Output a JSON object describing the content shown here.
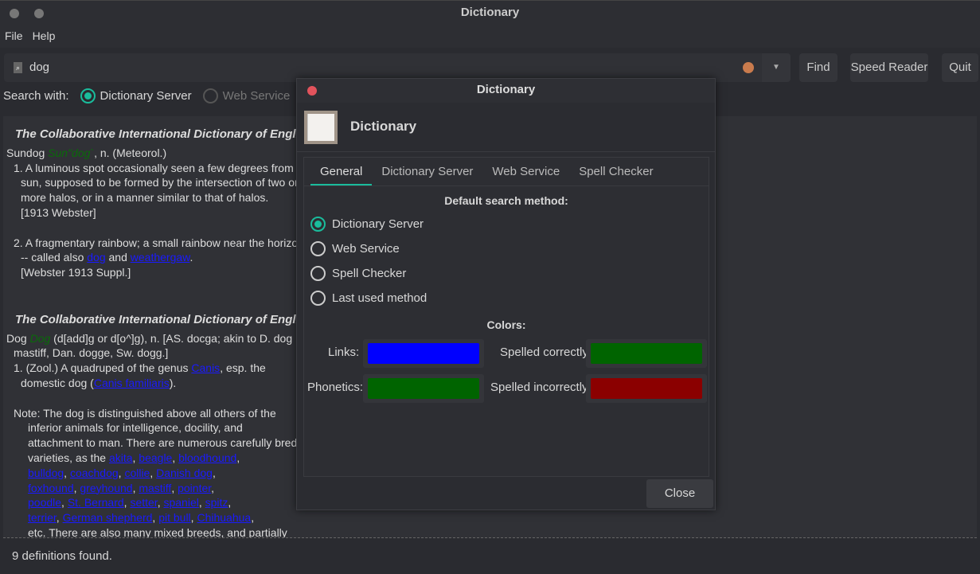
{
  "window": {
    "title": "Dictionary"
  },
  "menu": [
    "File",
    "Help"
  ],
  "search": {
    "value": "dog",
    "find": "Find",
    "speed_reader": "Speed Reader",
    "quit": "Quit"
  },
  "search_with": {
    "label": "Search with:",
    "options": [
      "Dictionary Server",
      "Web Service"
    ],
    "selected": "Dictionary Server"
  },
  "content": {
    "source": "The Collaborative International Dictionary of English v.0.48 (",
    "e1": {
      "word": "Sundog",
      "phon": "Sun\"dog`",
      "rest": ", n. (Meteorol.)",
      "d1": [
        "1. A luminous spot occasionally seen a few degrees from the",
        "sun, supposed to be formed by the intersection of two or",
        "more halos, or in a manner similar to that of halos.",
        "[1913 Webster]"
      ],
      "d2a": "2. A fragmentary rainbow; a small rainbow near the horizon;",
      "d2b": "-- called also ",
      "l1": "dog",
      "and": " and ",
      "l2": "weathergaw",
      "dot": ".",
      "d2c": "[Webster 1913 Suppl.]"
    },
    "e2": {
      "word": "Dog",
      "phon": "Dog",
      "rest": " (d[add]g or d[o^]g), n. [AS. docga; akin to D. dog",
      "l2": "mastiff, Dan. dogge, Sw. dogg.]",
      "z1": "1. (Zool.) A quadruped of the genus ",
      "canis": "Canis",
      "z2": ", esp. the",
      "z3": "domestic dog (",
      "cf": "Canis familiaris",
      "z4": ").",
      "note": [
        "Note: The dog is distinguished above all others of the",
        "inferior animals for intelligence, docility, and",
        "attachment to man. There are numerous carefully bred"
      ],
      "varieties": "varieties, as the ",
      "links": [
        [
          "akita",
          "beagle",
          "bloodhound"
        ],
        [
          "bulldog",
          "coachdog",
          "collie",
          "Danish dog"
        ],
        [
          "foxhound",
          "greyhound",
          "mastiff",
          "pointer"
        ],
        [
          "poodle",
          "St. Bernard",
          "setter",
          "spaniel",
          "spitz"
        ],
        [
          "terrier",
          "German shepherd",
          "pit bull",
          "Chihuahua"
        ]
      ],
      "last": "etc. There are also many mixed breeds, and partially"
    }
  },
  "status": "9 definitions found.",
  "dialog": {
    "title": "Dictionary",
    "app_name": "Dictionary",
    "tabs": [
      "General",
      "Dictionary Server",
      "Web Service",
      "Spell Checker"
    ],
    "active_tab": "General",
    "default_label": "Default search method:",
    "methods": [
      "Dictionary Server",
      "Web Service",
      "Spell Checker",
      "Last used method"
    ],
    "selected_method": "Dictionary Server",
    "colors_label": "Colors:",
    "colors": {
      "links_label": "Links:",
      "links": "#0000ff",
      "phonetics_label": "Phonetics:",
      "phonetics": "#006400",
      "correct_label": "Spelled correctly:",
      "correct": "#006400",
      "incorrect_label": "Spelled incorrectly:",
      "incorrect": "#8b0000"
    },
    "close": "Close"
  }
}
